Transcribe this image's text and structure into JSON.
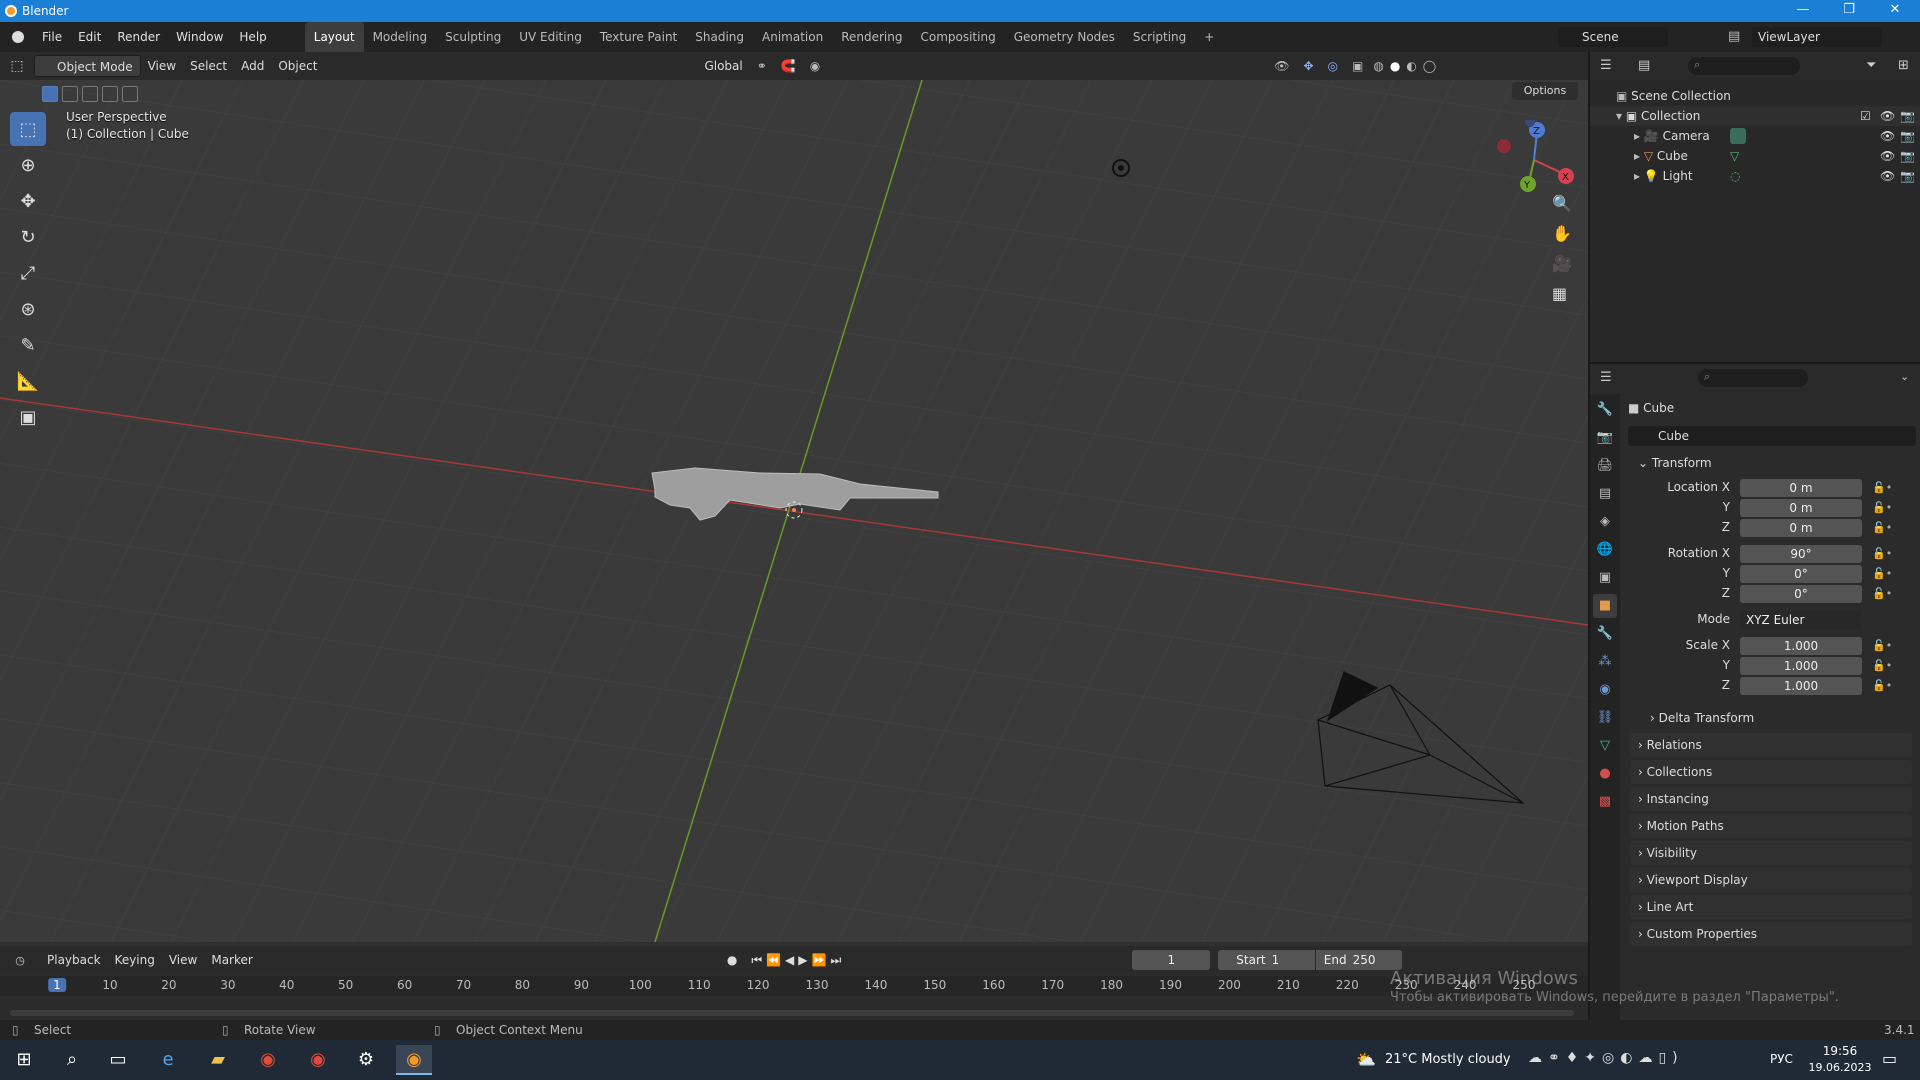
{
  "window": {
    "title": "Blender",
    "minimize": "—",
    "restore": "❐",
    "close": "✕"
  },
  "menu": [
    "File",
    "Edit",
    "Render",
    "Window",
    "Help"
  ],
  "workspaces": [
    "Layout",
    "Modeling",
    "Sculpting",
    "UV Editing",
    "Texture Paint",
    "Shading",
    "Animation",
    "Rendering",
    "Compositing",
    "Geometry Nodes",
    "Scripting",
    "+"
  ],
  "active_workspace": "Layout",
  "scene": {
    "name": "Scene",
    "viewlayer": "ViewLayer"
  },
  "viewport_header": {
    "mode": "Object Mode",
    "view": "View",
    "select": "Select",
    "add": "Add",
    "object": "Object",
    "orientation": "Global",
    "options": "Options"
  },
  "viewport": {
    "perspective": "User Perspective",
    "collection": "(1) Collection | Cube",
    "gizmo_z": "Z",
    "gizmo_y": "Y",
    "gizmo_x": "X"
  },
  "outliner": {
    "root": "Scene Collection",
    "collection": "Collection",
    "items": [
      "Camera",
      "Cube",
      "Light"
    ]
  },
  "properties": {
    "object_name": "Cube",
    "data_name": "Cube",
    "transform_title": "Transform",
    "location": {
      "label_x": "Location X",
      "label_y": "Y",
      "label_z": "Z",
      "x": "0 m",
      "y": "0 m",
      "z": "0 m"
    },
    "rotation": {
      "label_x": "Rotation X",
      "label_y": "Y",
      "label_z": "Z",
      "x": "90°",
      "y": "0°",
      "z": "0°"
    },
    "mode_label": "Mode",
    "mode_value": "XYZ Euler",
    "scale": {
      "label_x": "Scale X",
      "label_y": "Y",
      "label_z": "Z",
      "x": "1.000",
      "y": "1.000",
      "z": "1.000"
    },
    "delta": "Delta Transform",
    "panels": [
      "Relations",
      "Collections",
      "Instancing",
      "Motion Paths",
      "Visibility",
      "Viewport Display",
      "Line Art",
      "Custom Properties"
    ]
  },
  "timeline": {
    "playback": "Playback",
    "keying": "Keying",
    "view": "View",
    "marker": "Marker",
    "current": "1",
    "start_label": "Start",
    "start": "1",
    "end_label": "End",
    "end": "250",
    "ticks": [
      "1",
      "10",
      "20",
      "30",
      "40",
      "50",
      "60",
      "70",
      "80",
      "90",
      "100",
      "110",
      "120",
      "130",
      "140",
      "150",
      "160",
      "170",
      "180",
      "190",
      "200",
      "210",
      "220",
      "230",
      "240",
      "250"
    ]
  },
  "watermark": {
    "line1": "Активация Windows",
    "line2": "Чтобы активировать Windows, перейдите в раздел \"Параметры\"."
  },
  "status": {
    "select": "Select",
    "rotate": "Rotate View",
    "context": "Object Context Menu",
    "version": "3.4.1"
  },
  "taskbar": {
    "weather": "21°C  Mostly cloudy",
    "lang": "РУС",
    "time": "19:56",
    "date": "19.06.2023"
  }
}
